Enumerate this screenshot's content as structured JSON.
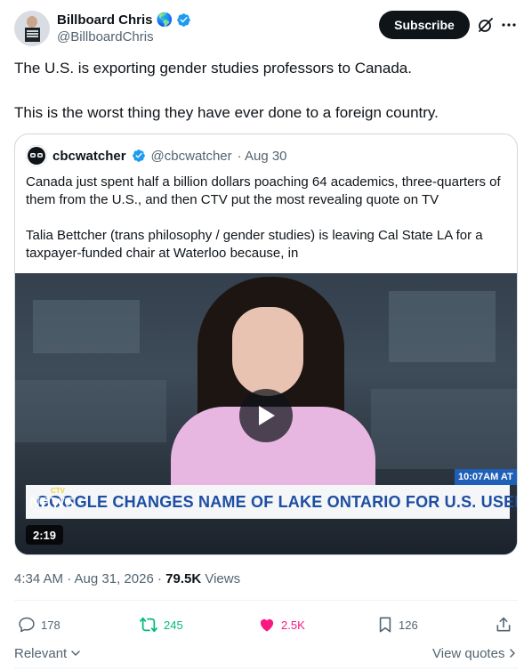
{
  "author": {
    "name": "Billboard Chris",
    "emoji": "🌎",
    "handle": "@BillboardChris",
    "subscribe_label": "Subscribe"
  },
  "tweet": {
    "paragraphs": [
      "The U.S. is exporting gender studies professors to Canada.",
      "This is the worst thing they have ever done to a foreign country."
    ]
  },
  "quote": {
    "name": "cbcwatcher",
    "handle": "@cbcwatcher",
    "date": "· Aug 30",
    "paragraphs": [
      "Canada just spent half a billion dollars poaching 64 academics, three-quarters of them from the U.S., and then CTV put the most revealing quote on TV",
      "Talia Bettcher (trans philosophy / gender studies) is leaving Cal State LA for a taxpayer-funded chair at Waterloo because, in"
    ],
    "video": {
      "time_badge": "10:07AM AT",
      "logo_ctv": "CTV",
      "logo_news": "NEWS",
      "logo_channel": "CHANNEL",
      "headline": "GOOGLE CHANGES NAME OF LAKE ONTARIO FOR U.S. USERS",
      "duration": "2:19"
    }
  },
  "meta": {
    "time": "4:34 AM",
    "date": "· Aug 31, 2026 ·",
    "views_count": "79.5K",
    "views_label": "Views"
  },
  "actions": {
    "replies": "178",
    "reposts": "245",
    "likes": "2.5K",
    "bookmarks": "126"
  },
  "footer": {
    "sort_label": "Relevant",
    "view_quotes": "View quotes"
  },
  "colors": {
    "accent": "#1d9bf0",
    "repost": "#00ba7c",
    "like": "#f91880",
    "secondary_text": "#536471"
  }
}
